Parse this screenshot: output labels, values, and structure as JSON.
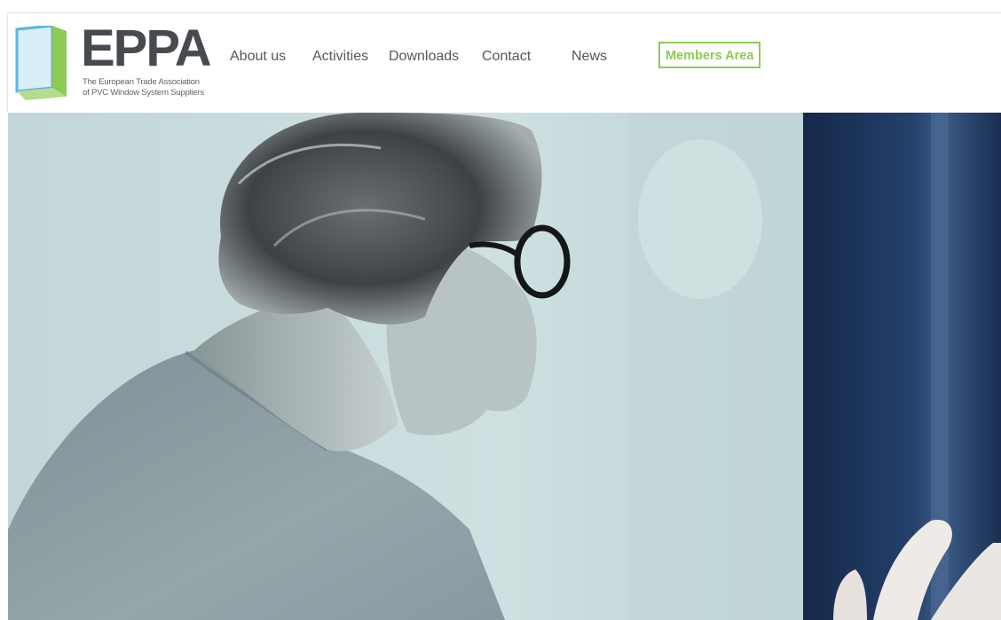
{
  "brand": {
    "name": "EPPA",
    "tagline_line1": "The European Trade Association",
    "tagline_line2": "of PVC Window System Suppliers",
    "colors": {
      "wordmark": "#474b4f",
      "accent_green": "#8ecb52",
      "accent_blue": "#5bb6e0"
    }
  },
  "nav": {
    "items": [
      {
        "label": "About us"
      },
      {
        "label": "Activities"
      },
      {
        "label": "Downloads"
      },
      {
        "label": "Contact"
      },
      {
        "label": "News"
      }
    ],
    "members_label": "Members Area"
  },
  "hero": {
    "image": "photo-of-man-with-glasses-looking-at-window",
    "colors": {
      "background": "#c6d8da",
      "curtain": "#1b2f52",
      "sweater": "#8e9ea4"
    }
  }
}
